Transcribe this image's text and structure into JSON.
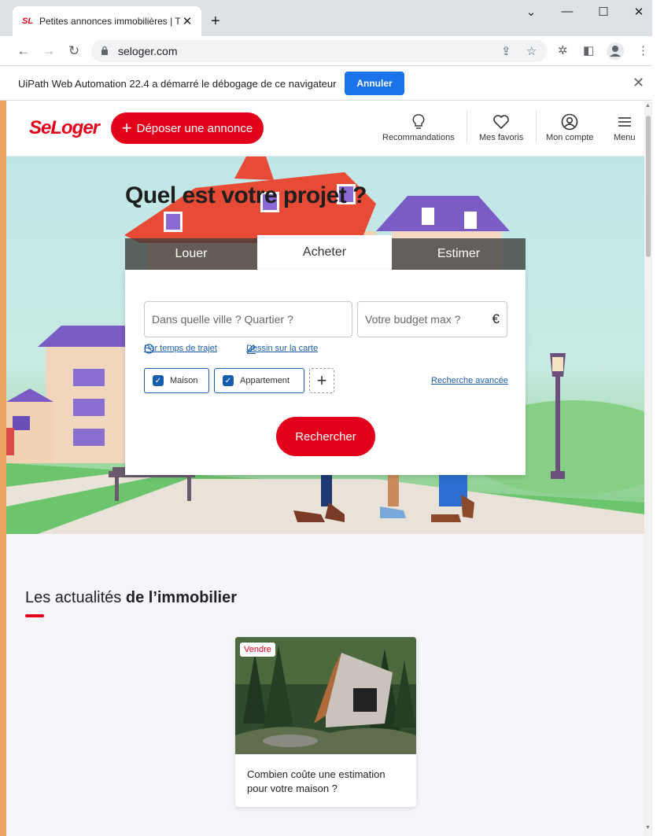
{
  "browser": {
    "tab_title": "Petites annonces immobilières | Tr",
    "tab_favicon": "SL",
    "url": "seloger.com",
    "infobar_text": "UiPath Web Automation 22.4 a démarré le débogage de ce navigateur",
    "infobar_button": "Annuler"
  },
  "header": {
    "logo": "SeLoger",
    "post_button": "Déposer une annonce",
    "nav": [
      {
        "label": "Recommandations",
        "icon": "lightbulb-icon"
      },
      {
        "label": "Mes favoris",
        "icon": "heart-icon"
      },
      {
        "label": "Mon compte",
        "icon": "user-icon"
      },
      {
        "label": "Menu",
        "icon": "hamburger-icon"
      }
    ]
  },
  "hero": {
    "title": "Quel est votre projet ?",
    "tabs": [
      "Louer",
      "Acheter",
      "Estimer"
    ],
    "active_tab": "Acheter",
    "city_placeholder": "Dans quelle ville ? Quartier ?",
    "budget_placeholder": "Votre budget max ?",
    "currency": "€",
    "link_travel": "Par temps de trajet",
    "link_draw": "Dessin sur la carte",
    "types": [
      {
        "label": "Maison",
        "checked": true
      },
      {
        "label": "Appartement",
        "checked": true
      }
    ],
    "advanced": "Recherche avancée",
    "search_button": "Rechercher"
  },
  "news": {
    "title_light": "Les actualités ",
    "title_bold": "de l’immobilier",
    "cards": [
      {
        "badge": "Vendre",
        "text": "Combien coûte une estimation pour votre maison ?"
      }
    ]
  },
  "colors": {
    "brand": "#e2001a",
    "link": "#1a5dad",
    "chrome_blue": "#1a73e8"
  }
}
